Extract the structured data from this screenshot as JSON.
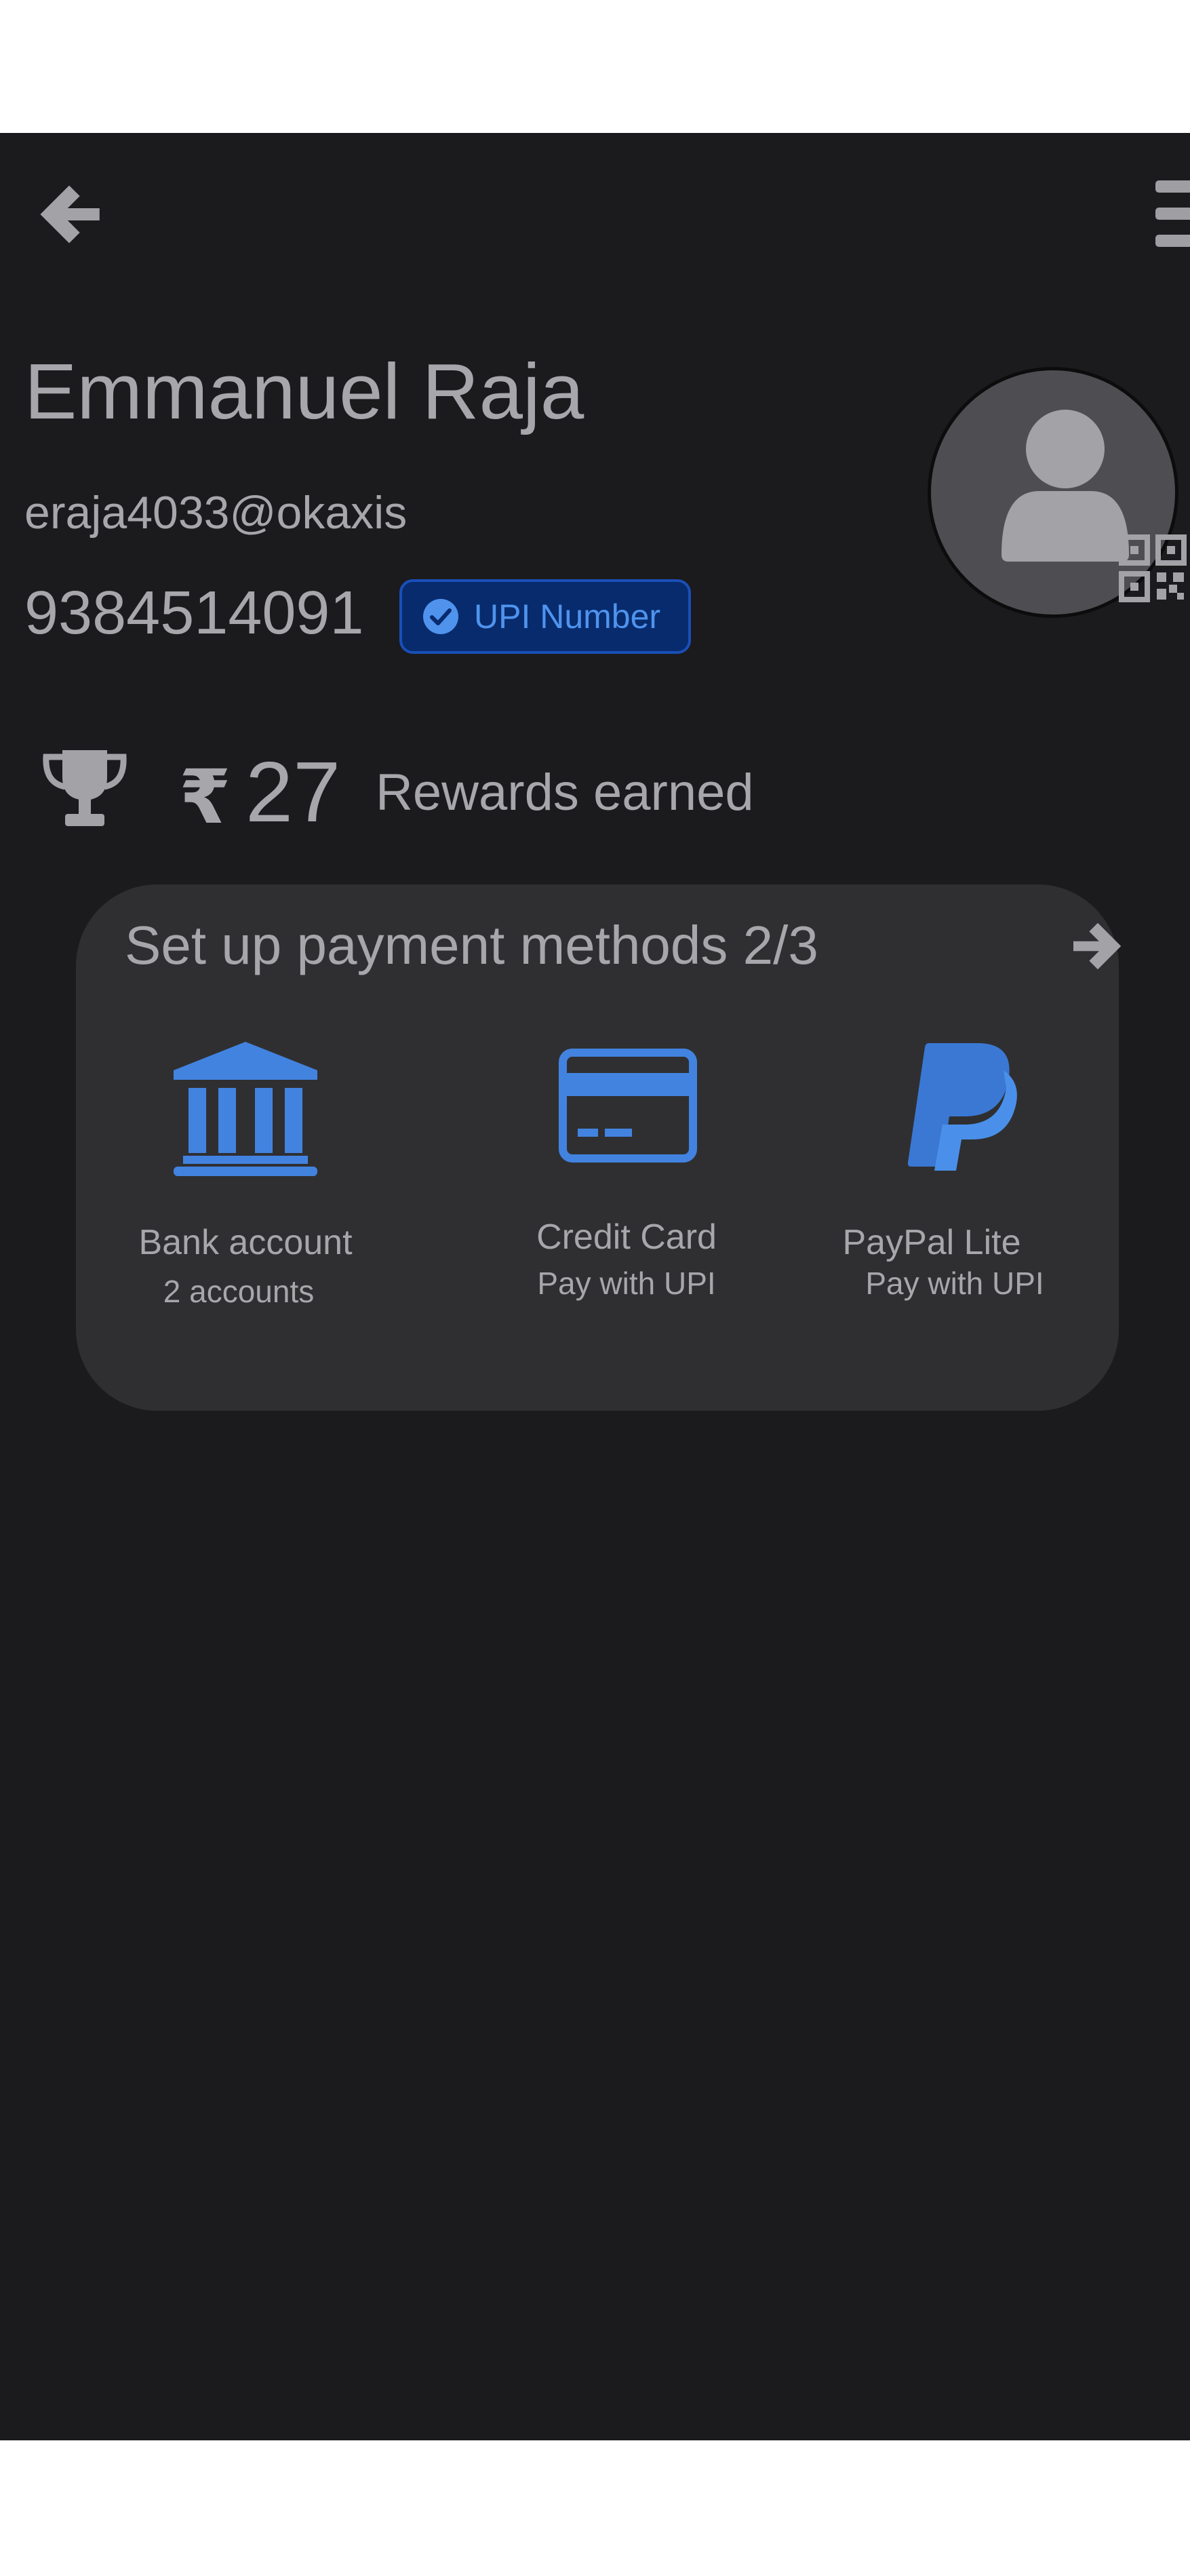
{
  "profile": {
    "name": "Emmanuel Raja",
    "upi_id": "eraja4033@okaxis",
    "phone": "9384514091",
    "badge_label": "UPI Number"
  },
  "rewards": {
    "currency_symbol": "₹",
    "amount": "27",
    "label": "Rewards earned"
  },
  "payment_setup": {
    "title": "Set up payment methods 2/3",
    "methods": [
      {
        "label": "Bank account",
        "sub": "2 accounts",
        "icon": "bank-icon"
      },
      {
        "label": "Credit Card",
        "sub": "Pay with UPI",
        "icon": "credit-card-icon"
      },
      {
        "label": "PayPal Lite",
        "sub": "Pay with UPI",
        "icon": "paypal-icon"
      }
    ]
  },
  "icons": {
    "back": "arrow-left-icon",
    "menu": "menu-icon",
    "avatar": "person-icon",
    "qr": "qr-code-icon",
    "trophy": "trophy-icon",
    "badge_check": "check-circle-icon",
    "card_arrow": "arrow-right-icon"
  },
  "colors": {
    "background": "#1b1a1d",
    "card": "#2f2f31",
    "text": "#a7a6aa",
    "accent_blue": "#4283e0",
    "badge_bg": "#072b6d",
    "badge_border": "#1a4fb8"
  }
}
